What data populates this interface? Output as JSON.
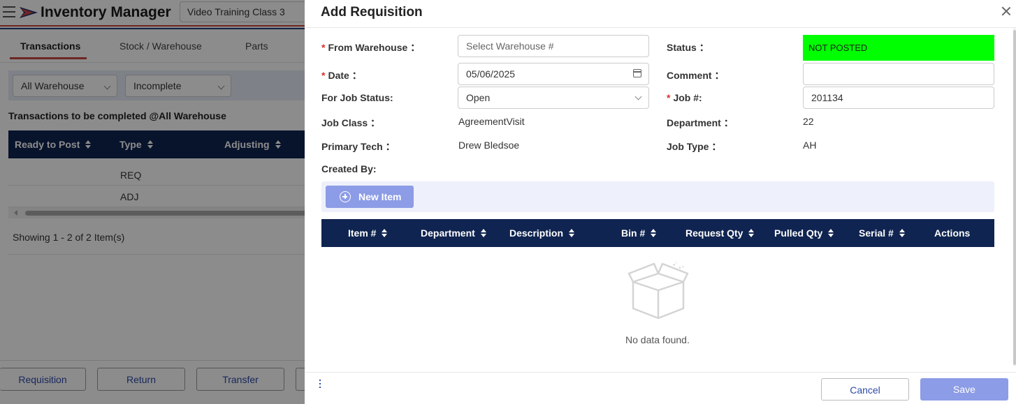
{
  "app": {
    "title": "Inventory Manager",
    "class_select_value": "Video Training Class 3"
  },
  "nav": {
    "tabs": [
      "Transactions",
      "Stock / Warehouse",
      "Parts"
    ]
  },
  "filters": {
    "warehouse": "All Warehouse",
    "status": "Incomplete"
  },
  "transactions": {
    "section_title": "Transactions to be completed @All Warehouse",
    "columns": [
      "Ready to Post",
      "Type",
      "Adjusting"
    ],
    "rows": [
      {
        "type": "REQ"
      },
      {
        "type": "ADJ"
      }
    ],
    "showing": "Showing 1 - 2 of 2 Item(s)"
  },
  "bottom_buttons": [
    "Requisition",
    "Return",
    "Transfer"
  ],
  "drawer": {
    "title": "Add Requisition",
    "fields": {
      "from_warehouse_label": "From Warehouse",
      "from_warehouse_placeholder": "Select Warehouse #",
      "date_label": "Date",
      "date_value": "05/06/2025",
      "job_status_label": "For Job Status:",
      "job_status_value": "Open",
      "job_class_label": "Job Class",
      "job_class_value": "AgreementVisit",
      "primary_tech_label": "Primary Tech",
      "primary_tech_value": "Drew Bledsoe",
      "created_by_label": "Created By:",
      "status_label": "Status",
      "status_value": "NOT POSTED",
      "comment_label": "Comment",
      "comment_value": "",
      "job_no_label": "Job #:",
      "job_no_value": "201134",
      "department_label": "Department",
      "department_value": "22",
      "job_type_label": "Job Type",
      "job_type_value": "AH"
    },
    "colon": "：",
    "required_mark": "*",
    "new_item_label": "New Item",
    "items_columns": [
      "Item #",
      "Department",
      "Description",
      "Bin #",
      "Request Qty",
      "Pulled Qty",
      "Serial #",
      "Actions"
    ],
    "empty_text": "No data found.",
    "cancel_label": "Cancel",
    "save_label": "Save"
  },
  "colors": {
    "header_navy": "#0f2450",
    "status_green": "#00ff00",
    "accent_red": "#c9453f",
    "button_blue": "#8c9ce6",
    "link_blue": "#2d4aa8"
  },
  "icons": [
    "hamburger-icon",
    "logo-icon",
    "chevron-down-icon",
    "calendar-icon",
    "close-icon",
    "plus-circle-icon",
    "sort-icon",
    "empty-box-icon",
    "more-dots-icon"
  ]
}
